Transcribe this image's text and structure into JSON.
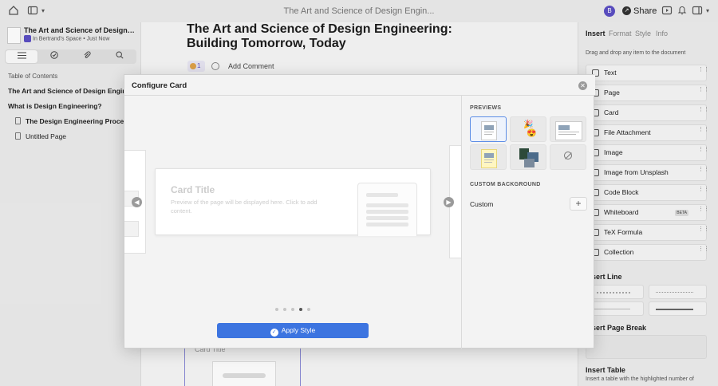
{
  "app": {
    "doc_title_top": "The Art and Science of Design Engin...",
    "avatar_initial": "B",
    "share_label": "Share"
  },
  "sidebar": {
    "workspace_title": "The Art and Science of Design Engi...",
    "workspace_sub": "In Bertrand's Space • Just Now",
    "toc_label": "Table of Contents",
    "items": [
      {
        "label": "The Art and Science of Design Engineering: Building Tomorrow, Today"
      },
      {
        "label": "What is Design Engineering?"
      },
      {
        "label": "The Design Engineering Process"
      },
      {
        "label": "Untitled Page"
      }
    ]
  },
  "document": {
    "title": "The Art and Science of Design Engineering: Building Tomorrow, Today",
    "reaction_count": "1",
    "add_comment": "Add Comment",
    "card_title": "Card Title"
  },
  "right_panel": {
    "tabs": [
      "Insert",
      "Format",
      "Style",
      "Info"
    ],
    "hint": "Drag and drop any item to the document",
    "items": [
      "Text",
      "Page",
      "Card",
      "File Attachment",
      "Image",
      "Image from Unsplash",
      "Code Block",
      "Whiteboard",
      "TeX Formula",
      "Collection"
    ],
    "beta": "BETA",
    "section_line": "Insert Line",
    "section_break": "Insert Page Break",
    "section_table": "Insert Table",
    "table_desc": "Insert a table with the highlighted number of"
  },
  "modal": {
    "title": "Configure Card",
    "card_title": "Card Title",
    "card_desc": "Preview of the page will be displayed here. Click to add content.",
    "apply_label": "Apply Style",
    "previews_label": "PREVIEWS",
    "custom_bg_label": "CUSTOM BACKGROUND",
    "custom_label": "Custom",
    "pager": {
      "count": 5,
      "active": 4
    }
  },
  "colors": {
    "accent": "#3c74e0",
    "avatar": "#5b4fc4"
  }
}
